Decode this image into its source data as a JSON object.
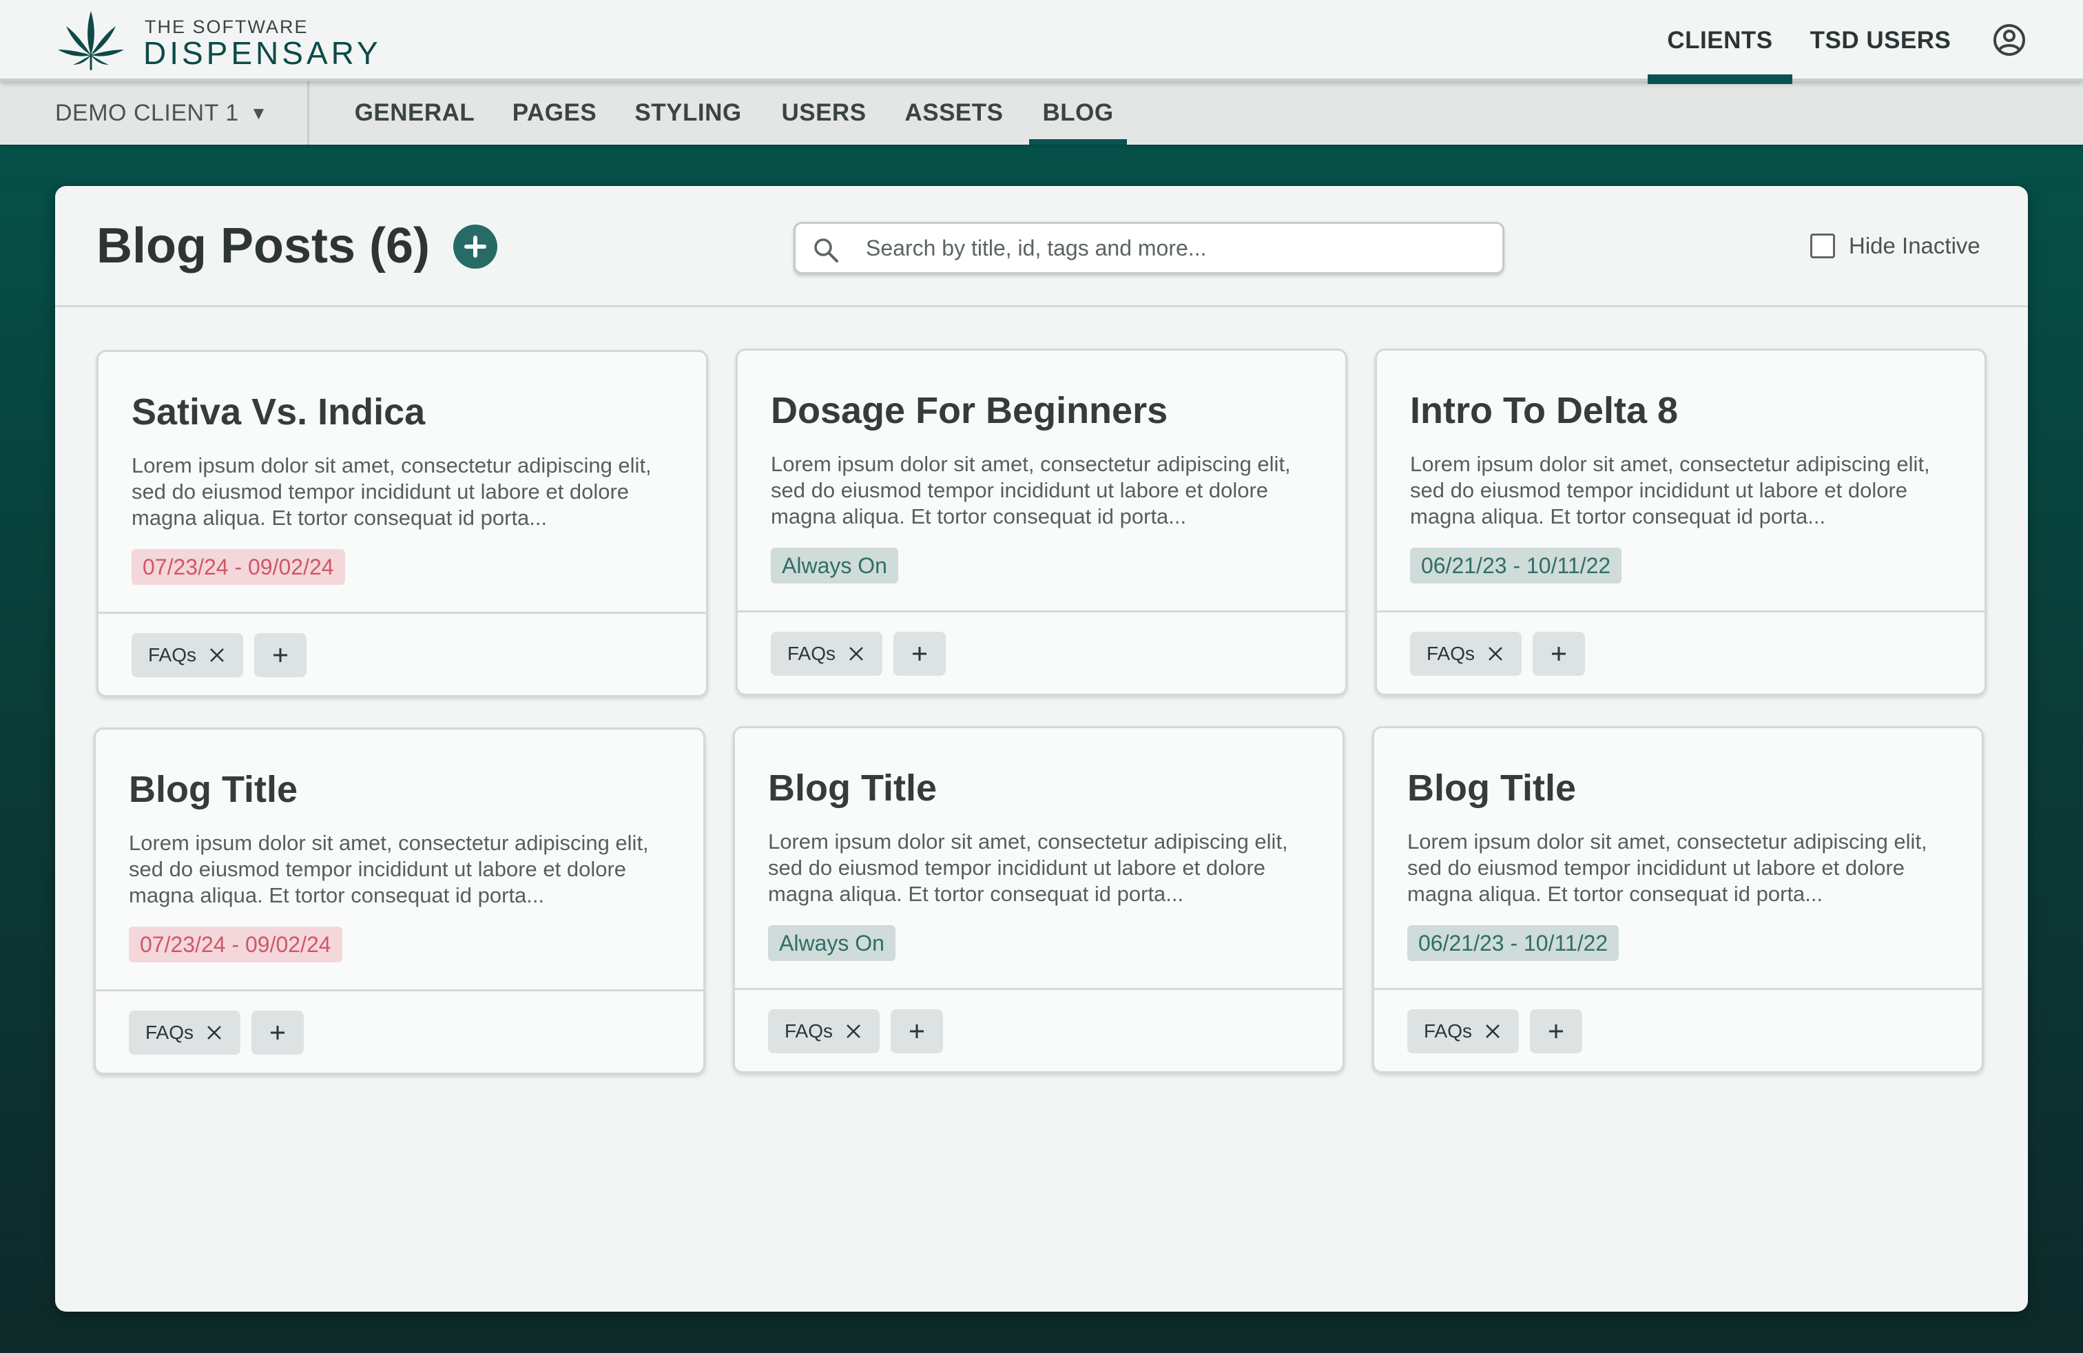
{
  "brand": {
    "line1": "THE SOFTWARE",
    "line2": "DISPENSARY",
    "logo_icon": "cannabis-leaf-icon",
    "logo_color": "#0d4a48"
  },
  "top_nav": {
    "items": [
      {
        "label": "CLIENTS",
        "active": true
      },
      {
        "label": "TSD USERS",
        "active": false
      }
    ],
    "account_icon": "user-circle-icon"
  },
  "sub_nav": {
    "client_selector": {
      "value": "DEMO CLIENT 1",
      "icon": "caret-down-icon"
    },
    "tabs": [
      {
        "label": "GENERAL",
        "active": false
      },
      {
        "label": "PAGES",
        "active": false
      },
      {
        "label": "STYLING",
        "active": false
      },
      {
        "label": "USERS",
        "active": false
      },
      {
        "label": "ASSETS",
        "active": false
      },
      {
        "label": "BLOG",
        "active": true
      }
    ]
  },
  "panel": {
    "title": "Blog Posts (6)",
    "add_icon": "plus-circle-icon",
    "search": {
      "placeholder": "Search by title, id, tags and more...",
      "value": "",
      "icon": "search-icon"
    },
    "hide_inactive": {
      "label": "Hide Inactive",
      "checked": false
    }
  },
  "posts": [
    {
      "title": "Sativa Vs. Indica",
      "excerpt": "Lorem ipsum dolor sit amet, consectetur adipiscing elit, sed do eiusmod tempor incididunt ut labore et dolore magna aliqua. Et tortor consequat id porta...",
      "schedule": "07/23/24 - 09/02/24",
      "status": "expired",
      "tags": [
        "FAQs"
      ]
    },
    {
      "title": "Dosage For Beginners",
      "excerpt": "Lorem ipsum dolor sit amet, consectetur adipiscing elit, sed do eiusmod tempor incididunt ut labore et dolore magna aliqua. Et tortor consequat id porta...",
      "schedule": "Always On",
      "status": "active",
      "tags": [
        "FAQs"
      ]
    },
    {
      "title": "Intro To Delta 8",
      "excerpt": "Lorem ipsum dolor sit amet, consectetur adipiscing elit, sed do eiusmod tempor incididunt ut labore et dolore magna aliqua. Et tortor consequat id porta...",
      "schedule": "06/21/23 - 10/11/22",
      "status": "active",
      "tags": [
        "FAQs"
      ]
    },
    {
      "title": "Blog Title",
      "excerpt": "Lorem ipsum dolor sit amet, consectetur adipiscing elit, sed do eiusmod tempor incididunt ut labore et dolore magna aliqua. Et tortor consequat id porta...",
      "schedule": "07/23/24 - 09/02/24",
      "status": "expired",
      "tags": [
        "FAQs"
      ]
    },
    {
      "title": "Blog Title",
      "excerpt": "Lorem ipsum dolor sit amet, consectetur adipiscing elit, sed do eiusmod tempor incididunt ut labore et dolore magna aliqua. Et tortor consequat id porta...",
      "schedule": "Always On",
      "status": "active",
      "tags": [
        "FAQs"
      ]
    },
    {
      "title": "Blog Title",
      "excerpt": "Lorem ipsum dolor sit amet, consectetur adipiscing elit, sed do eiusmod tempor incididunt ut labore et dolore magna aliqua. Et tortor consequat id porta...",
      "schedule": "06/21/23 - 10/11/22",
      "status": "active",
      "tags": [
        "FAQs"
      ]
    }
  ],
  "colors": {
    "accent": "#0a5450",
    "expired_badge_bg": "#f4d7da",
    "expired_badge_text": "#d0566a",
    "active_badge_bg": "#cfdcd9",
    "active_badge_text": "#2f6e67"
  }
}
